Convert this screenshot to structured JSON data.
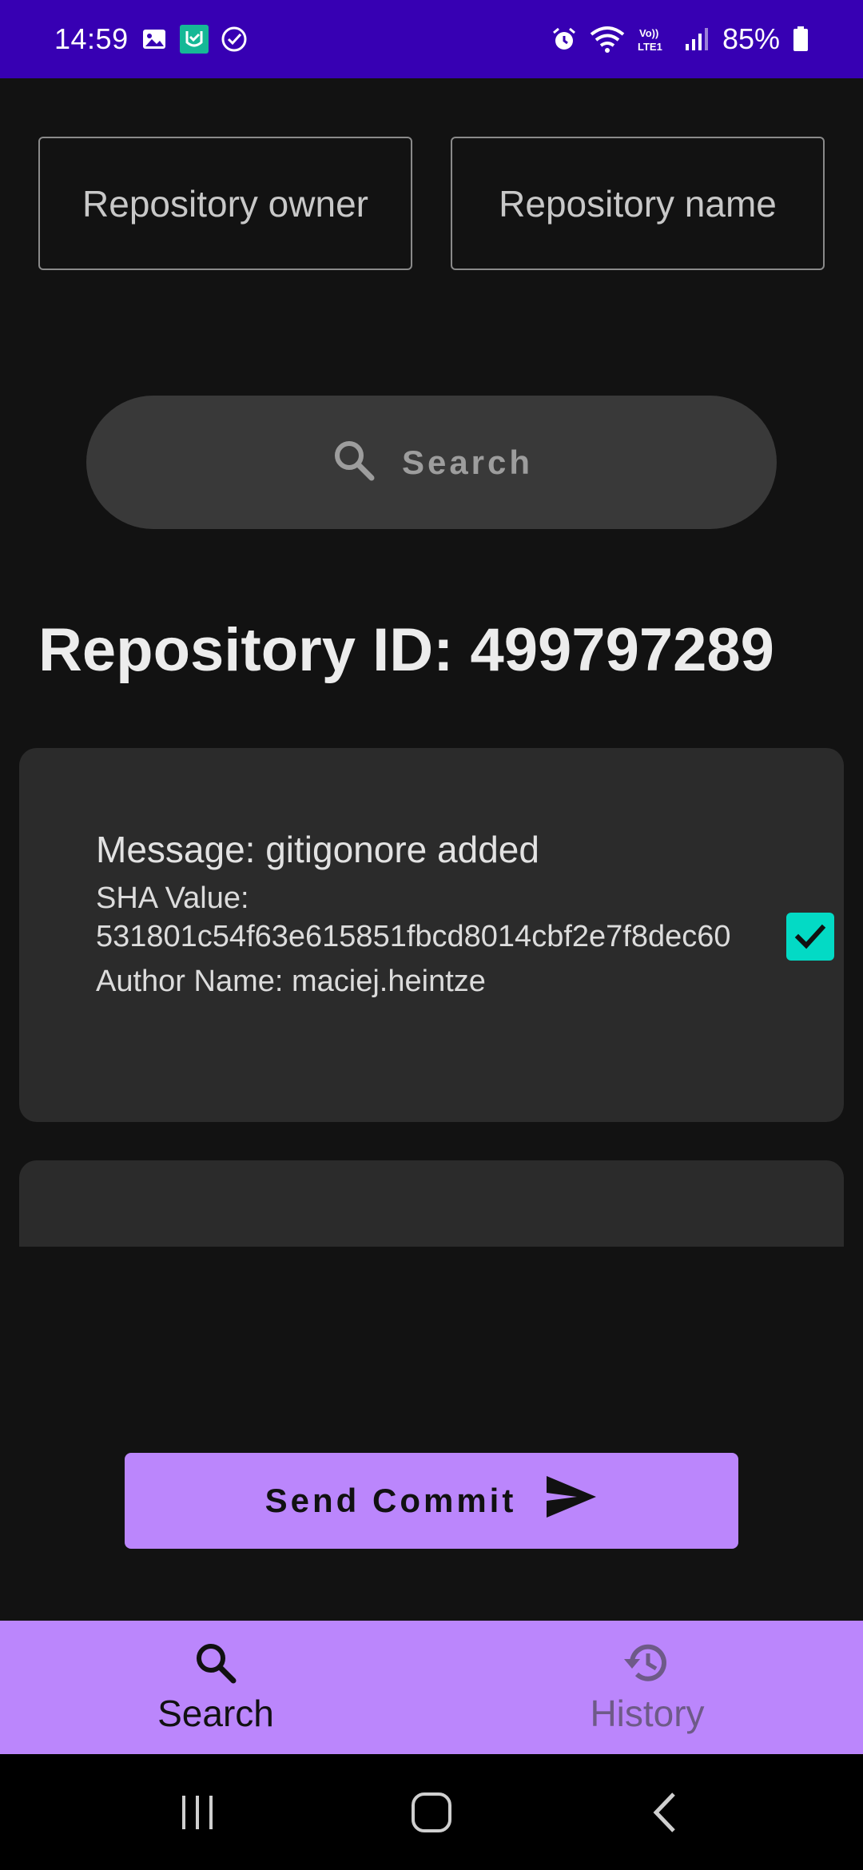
{
  "status_bar": {
    "time": "14:59",
    "battery_percent": "85%",
    "left_icons": [
      "gallery-icon",
      "app-badge-icon",
      "check-circle-icon"
    ],
    "right_icons": [
      "alarm-icon",
      "wifi-icon",
      "volte-icon",
      "signal-icon",
      "battery-icon"
    ],
    "volte_text": "Vo)) LTE1"
  },
  "form": {
    "owner_placeholder": "Repository owner",
    "owner_value": "",
    "name_placeholder": "Repository name",
    "name_value": ""
  },
  "search_button": {
    "label": "Search",
    "icon": "search-icon"
  },
  "repository": {
    "id_text": "Repository ID: 499797289"
  },
  "commits": [
    {
      "message": "Message: gitigonore added",
      "sha_label": "SHA Value:",
      "sha": "531801c54f63e615851fbcd8014cbf2e7f8dec60",
      "author": "Author Name: maciej.heintze",
      "checked": true
    }
  ],
  "send_button": {
    "label": "Send Commit",
    "icon": "send-icon"
  },
  "bottom_nav": {
    "items": [
      {
        "label": "Search",
        "icon": "search-icon",
        "active": true
      },
      {
        "label": "History",
        "icon": "history-icon",
        "active": false
      }
    ]
  },
  "colors": {
    "status_bar": "#3700b3",
    "background": "#121212",
    "accent": "#bb86fc",
    "checkbox": "#03dac5",
    "card": "#2b2b2b"
  }
}
